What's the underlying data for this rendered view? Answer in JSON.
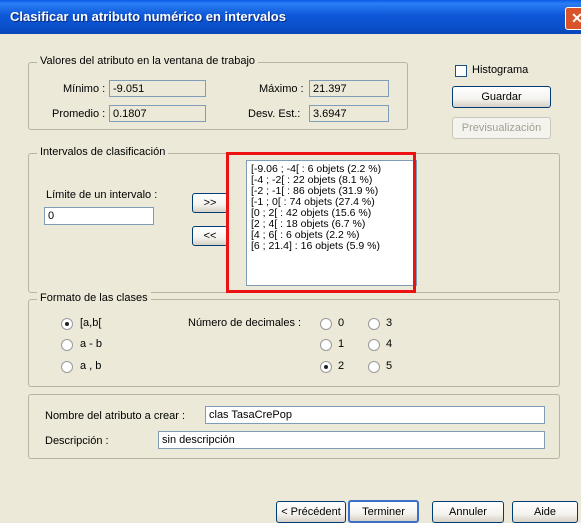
{
  "window": {
    "title": "Clasificar un atributo numérico en intervalos",
    "close_glyph": "✕",
    "accent_color": "#0a5ae6",
    "highlight_color": "#ee1111"
  },
  "stats": {
    "legend": "Valores del atributo en la ventana de trabajo",
    "min_label": "Mínimo :",
    "min_value": "-9.051",
    "max_label": "Máximo :",
    "max_value": "21.397",
    "mean_label": "Promedio :",
    "mean_value": "0.1807",
    "std_label": "Desv. Est.:",
    "std_value": "3.6947"
  },
  "side": {
    "histogram_label": "Histograma",
    "histogram_checked": false,
    "save_label": "Guardar",
    "preview_label": "Previsualización"
  },
  "intervals": {
    "legend": "Intervalos de clasificación",
    "limit_label": "Límite de un intervalo :",
    "limit_value": "0",
    "add_label": ">>",
    "remove_label": "<<",
    "list": [
      "[-9.06 ; -4[   : 6 objets (2.2 %)",
      "[-4 ; -2[   : 22 objets (8.1 %)",
      "[-2 ; -1[   : 86 objets (31.9 %)",
      "[-1 ; 0[   : 74 objets (27.4 %)",
      "[0 ; 2[   : 42 objets (15.6 %)",
      "[2 ; 4[   : 18 objets (6.7 %)",
      "[4 ; 6[   : 6 objets (2.2 %)",
      "[6 ; 21.4]   : 16 objets (5.9 %)"
    ]
  },
  "format": {
    "legend": "Formato de las clases",
    "class_options": [
      "[a,b[",
      "a - b",
      "a , b"
    ],
    "class_selected": 0,
    "decimals_label": "Número de decimales :",
    "decimals_options": [
      "0",
      "1",
      "2",
      "3",
      "4",
      "5"
    ],
    "decimals_selected": "2"
  },
  "attribute": {
    "name_label": "Nombre del atributo a crear :",
    "name_value": "clas TasaCrePop",
    "desc_label": "Descripción :",
    "desc_value": "sin descripción"
  },
  "footer": {
    "prev_label": "< Précédent",
    "finish_label": "Terminer",
    "cancel_label": "Annuler",
    "help_label": "Aide"
  }
}
